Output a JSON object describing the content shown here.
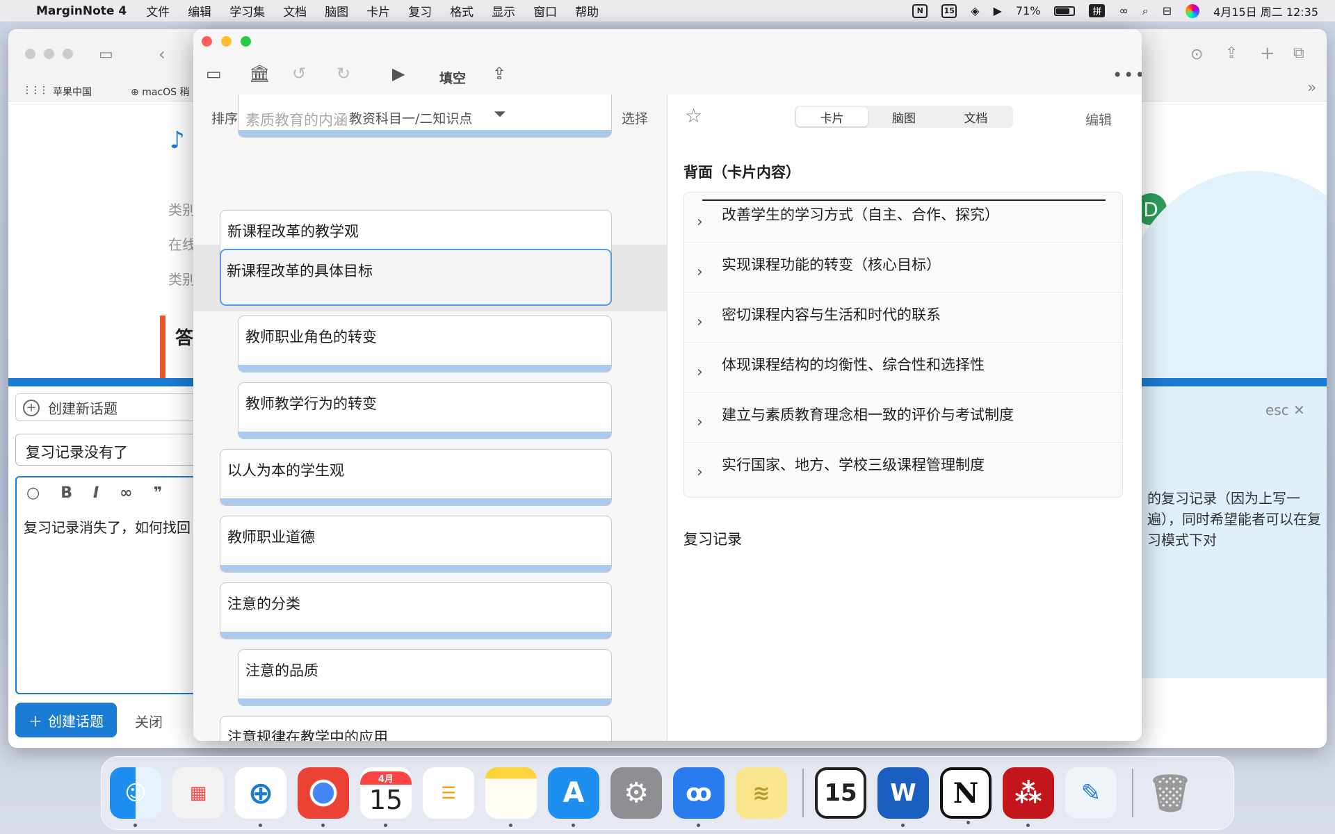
{
  "menubar": {
    "app": "MarginNote 4",
    "items": [
      "文件",
      "编辑",
      "学习集",
      "文档",
      "脑图",
      "卡片",
      "复习",
      "格式",
      "显示",
      "窗口",
      "帮助"
    ],
    "battery": "71%",
    "clock": "4月15日 周二 12:35",
    "calendar_badge": "15",
    "input_method": "拼"
  },
  "browser": {
    "bookmarks": [
      "苹果中国",
      "macOS 稍"
    ],
    "new_topic": "创建新话题",
    "record_input": "复习记录没有了",
    "editor_text": "复习记录消失了，如何找回",
    "create_button": "创建话题",
    "close_button": "关闭",
    "esc": "esc",
    "avatar_letter": "D",
    "side_lines": [
      "类别",
      "在线",
      "类别",
      "答"
    ],
    "right_text": "的复习记录（因为上写一遍），同时希望能者可以在复习模式下对"
  },
  "toolbar": {
    "fill": "填空"
  },
  "left": {
    "sort": "排序",
    "filter": "教资科目一/二知识点",
    "select": "选择",
    "cards": [
      "素质教育的内涵",
      "新课程改革的教学观",
      "新课程改革的具体目标",
      "教师职业角色的转变",
      "教师教学行为的转变",
      "以人为本的学生观",
      "教师职业道德",
      "注意的分类",
      "注意的品质",
      "注意规律在教学中的应用"
    ]
  },
  "right": {
    "tabs": [
      "卡片",
      "脑图",
      "文档"
    ],
    "edit": "编辑",
    "back_title": "背面（卡片内容）",
    "items": [
      "改善学生的学习方式（自主、合作、探究）",
      "实现课程功能的转变（核心目标）",
      "密切课程内容与生活和时代的联系",
      "体现课程结构的均衡性、综合性和选择性",
      "建立与素质教育理念相一致的评价与考试制度",
      "实行国家、地方、学校三级课程管理制度"
    ],
    "review_title": "复习记录"
  },
  "dock": {
    "calendar_month": "4月",
    "calendar_day": "15",
    "fantastical_day": "15"
  },
  "colors": {
    "accent": "#1a7bd3",
    "card_bar": "#a9c9f0",
    "selection": "#e6e6e8"
  }
}
